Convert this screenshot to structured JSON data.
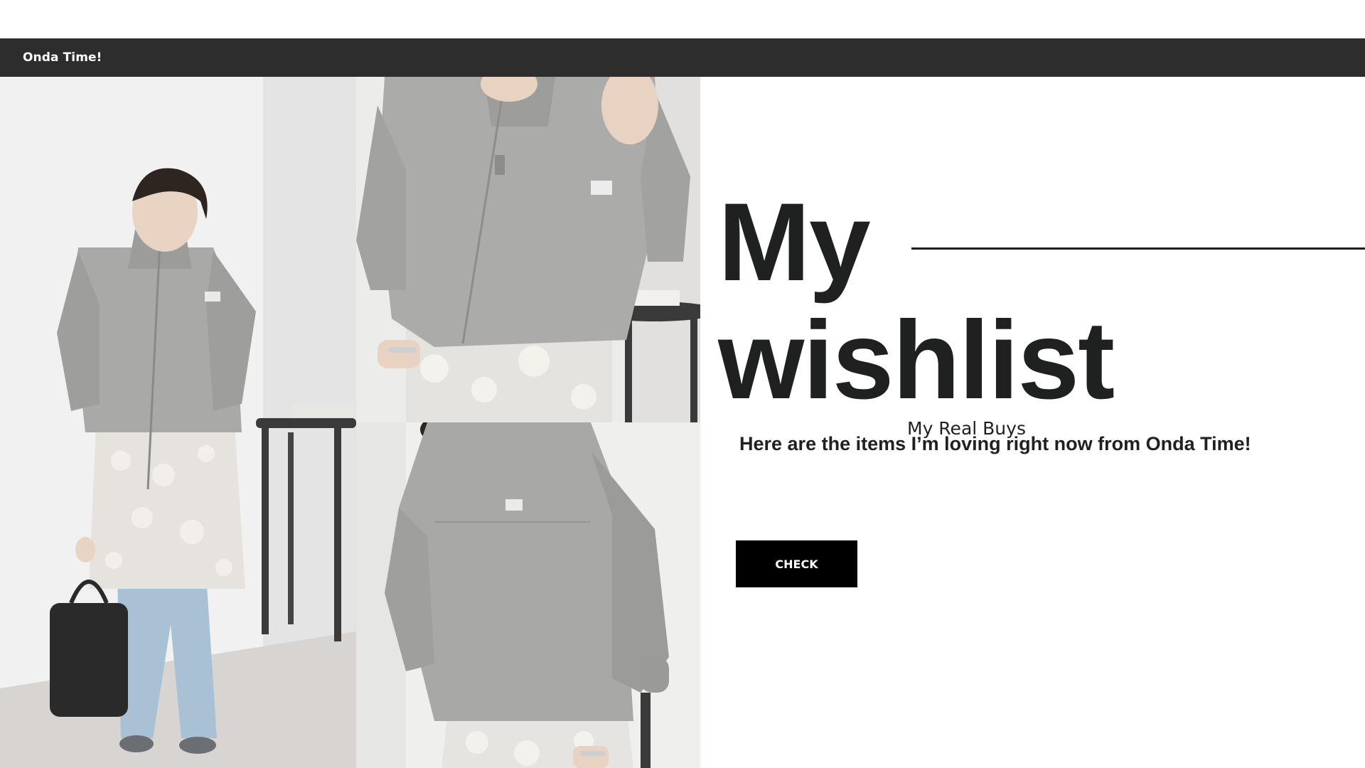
{
  "header": {
    "brand": "Onda Time!"
  },
  "gallery": {
    "photos": [
      {
        "name": "model-front-full-photo"
      },
      {
        "name": "jacket-closeup-photo"
      },
      {
        "name": "jacket-back-photo"
      }
    ]
  },
  "hero": {
    "title_line1": "My",
    "title_line2": "wishlist",
    "overlay_label": "My Real Buys",
    "subtitle": "Here are the items I’m loving right now from Onda Time!",
    "cta_label": "CHECK"
  },
  "colors": {
    "topbar": "#2d2d2d",
    "title": "#1f2020",
    "button": "#000000",
    "jacket": "#a9a9a7"
  }
}
